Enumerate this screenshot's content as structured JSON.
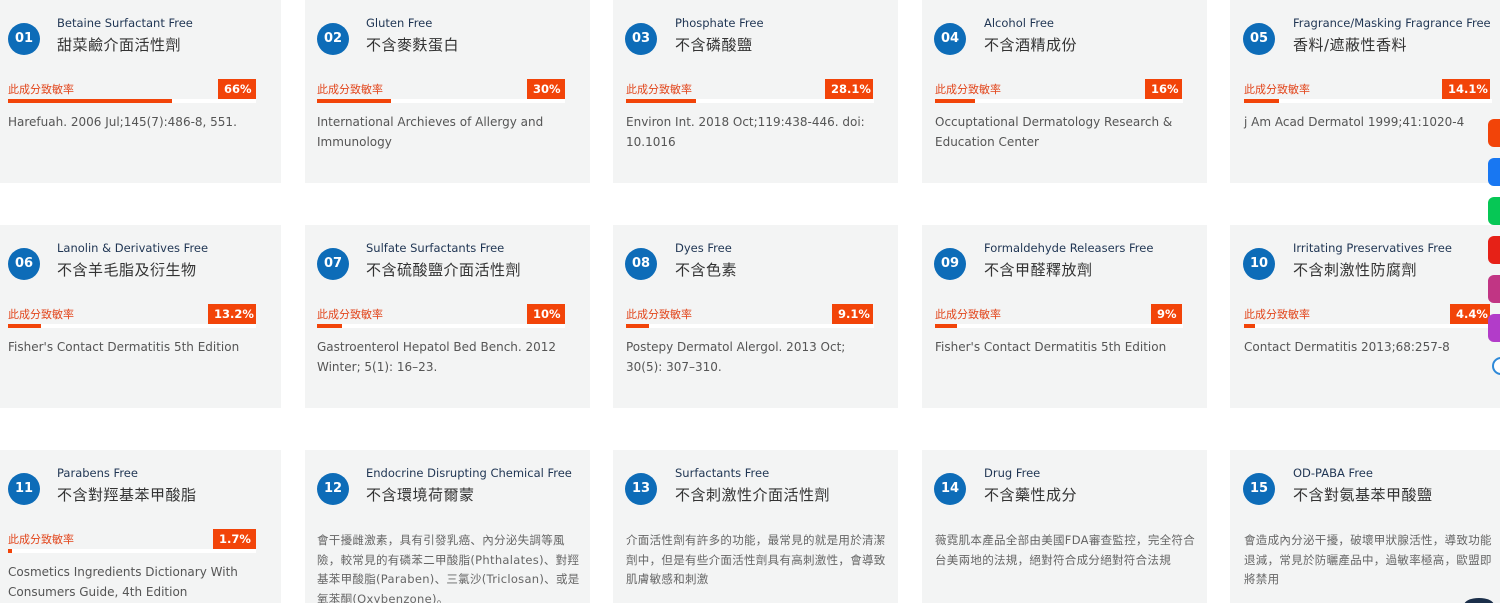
{
  "sensitivity_label": "此成分致敏率",
  "cards": [
    {
      "num": "01",
      "en": "Betaine Surfactant Free",
      "zh": "甜菜鹼介面活性劑",
      "rate": "66%",
      "rate_value": 66,
      "source": "Harefuah. 2006 Jul;145(7):486-8, 551."
    },
    {
      "num": "02",
      "en": "Gluten Free",
      "zh": "不含麥麩蛋白",
      "rate": "30%",
      "rate_value": 30,
      "source": "International Archieves of Allergy and Immunology"
    },
    {
      "num": "03",
      "en": "Phosphate Free",
      "zh": "不含磷酸鹽",
      "rate": "28.1%",
      "rate_value": 28.1,
      "source": "Environ Int. 2018 Oct;119:438-446. doi: 10.1016"
    },
    {
      "num": "04",
      "en": "Alcohol Free",
      "zh": "不含酒精成份",
      "rate": "16%",
      "rate_value": 16,
      "source": "Occuptational Dermatology Research & Education Center"
    },
    {
      "num": "05",
      "en": "Fragrance/Masking Fragrance Free",
      "zh": "香料/遮蔽性香料",
      "rate": "14.1%",
      "rate_value": 14.1,
      "source": "j Am Acad Dermatol 1999;41:1020-4"
    },
    {
      "num": "06",
      "en": "Lanolin & Derivatives Free",
      "zh": "不含羊毛脂及衍生物",
      "rate": "13.2%",
      "rate_value": 13.2,
      "source": "Fisher's Contact Dermatitis 5th Edition"
    },
    {
      "num": "07",
      "en": "Sulfate Surfactants Free",
      "zh": "不含硫酸鹽介面活性劑",
      "rate": "10%",
      "rate_value": 10,
      "source": "Gastroenterol Hepatol Bed Bench. 2012 Winter; 5(1): 16–23."
    },
    {
      "num": "08",
      "en": "Dyes Free",
      "zh": "不含色素",
      "rate": "9.1%",
      "rate_value": 9.1,
      "source": "Postepy Dermatol Alergol. 2013 Oct; 30(5): 307–310."
    },
    {
      "num": "09",
      "en": "Formaldehyde Releasers Free",
      "zh": "不含甲醛釋放劑",
      "rate": "9%",
      "rate_value": 9,
      "source": "Fisher's Contact Dermatitis 5th Edition"
    },
    {
      "num": "10",
      "en": "Irritating Preservatives Free",
      "zh": "不含刺激性防腐劑",
      "rate": "4.4%",
      "rate_value": 4.4,
      "source": "Contact Dermatitis 2013;68:257-8"
    },
    {
      "num": "11",
      "en": "Parabens Free",
      "zh": "不含對羥基苯甲酸脂",
      "rate": "1.7%",
      "rate_value": 1.7,
      "source": "Cosmetics Ingredients Dictionary With Consumers Guide, 4th Edition"
    },
    {
      "num": "12",
      "en": "Endocrine Disrupting Chemical Free",
      "zh": "不含環境荷爾蒙",
      "description": "會干擾雌激素，具有引發乳癌、內分泌失調等風險，較常見的有磷苯二甲酸脂(Phthalates)、對羥基苯甲酸脂(Paraben)、三氯沙(Triclosan)、或是氧苯酮(Oxybenzone)。"
    },
    {
      "num": "13",
      "en": "Surfactants Free",
      "zh": "不含刺激性介面活性劑",
      "description": "介面活性劑有許多的功能，最常見的就是用於清潔劑中，但是有些介面活性劑具有高刺激性，會導致肌膚敏感和刺激"
    },
    {
      "num": "14",
      "en": "Drug Free",
      "zh": "不含藥性成分",
      "description": "薇霓肌本產品全部由美國FDA審查監控，完全符合台美兩地的法規，絕對符合成分絕對符合法規"
    },
    {
      "num": "15",
      "en": "OD-PABA Free",
      "zh": "不含對氨基苯甲酸鹽",
      "description": "會造成內分泌干擾，破壞甲狀腺活性，導致功能退減，常見於防曬產品中，過敏率極高，歐盟即將禁用"
    }
  ],
  "social": [
    {
      "icon": "home-icon",
      "color": "#f24409"
    },
    {
      "icon": "facebook-icon",
      "color": "#1877f2"
    },
    {
      "icon": "line-icon",
      "color": "#06c755"
    },
    {
      "icon": "youtube-icon",
      "color": "#e62117"
    },
    {
      "icon": "instagram-icon",
      "color": "#c13584"
    },
    {
      "icon": "threads-icon",
      "color": "#b23cc9"
    }
  ]
}
